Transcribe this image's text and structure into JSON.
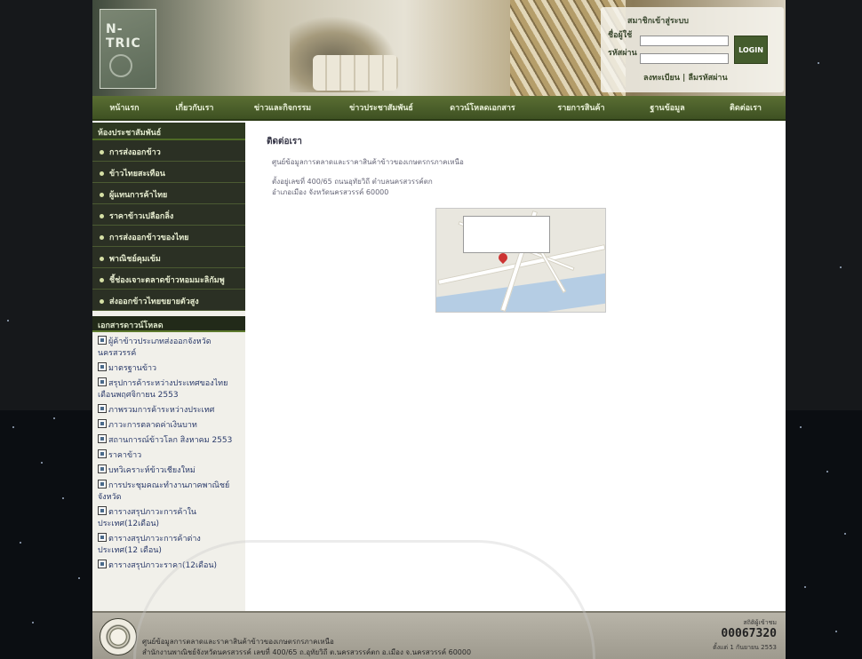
{
  "header": {
    "logo_text": "N-TRIC",
    "login": {
      "title": "สมาชิกเข้าสู่ระบบ",
      "username_label": "ชื่อผู้ใช้",
      "password_label": "รหัสผ่าน",
      "username_placeholder": "",
      "password_placeholder": "",
      "button_label": "LOGIN",
      "links": "ลงทะเบียน | ลืมรหัสผ่าน"
    }
  },
  "nav": {
    "items": [
      "หน้าแรก",
      "เกี่ยวกับเรา",
      "ข่าวและกิจกรรม",
      "ข่าวประชาสัมพันธ์",
      "ดาวน์โหลดเอกสาร",
      "รายการสินค้า",
      "ฐานข้อมูล",
      "ติดต่อเรา"
    ]
  },
  "sidebar": {
    "title": "ห้องประชาสัมพันธ์",
    "items": [
      "การส่งออกข้าว",
      "ข้าวไทยสะเทือน",
      "ผู้แทนการค้าไทย",
      "ราคาข้าวเปลือกลิ่ง",
      "การส่งออกข้าวของไทย",
      "พาณิชย์คุมเข้ม",
      "ชี้ช่องเจาะตลาดข้าวหอมมะลิกัมพู",
      "ส่งออกข้าวไทยขยายตัวสูง"
    ],
    "docs_title": "เอกสารดาวน์โหลด",
    "docs": [
      "ผู้ค้าข้าวประเภทส่งออกจังหวัดนครสวรรค์",
      "มาตรฐานข้าว",
      "สรุปการค้าระหว่างประเทศของไทย เดือนพฤศจิกายน 2553",
      "ภาพรวมการค้าระหว่างประเทศ",
      "ภาวะการตลาดค่าเงินบาท",
      "สถานการณ์ข้าวโลก สิงหาคม 2553",
      "ราคาข้าว",
      "บทวิเคราะห์ข้าวเชียงใหม่",
      "การประชุมคณะทำงานภาคพาณิชย์จังหวัด",
      "ตารางสรุปภาวะการค้าในประเทศ(12เดือน)",
      "ตารางสรุปภาวะการค้าต่างประเทศ(12 เดือน)",
      "ตารางสรุปภาวะราคา(12เดือน)"
    ]
  },
  "content": {
    "title": "ติดต่อเรา",
    "org": "ศูนย์ข้อมูลการตลาดและราคาสินค้าข้าวของเกษตรกรภาคเหนือ",
    "address1": "ตั้งอยู่เลขที่ 400/65 ถนนอุทัยวิถี ตำบลนครสวรรค์ตก",
    "address2": "อำเภอเมือง จังหวัดนครสวรรค์ 60000"
  },
  "footer": {
    "line1": "ศูนย์ข้อมูลการตลาดและราคาสินค้าข้าวของเกษตรกรภาคเหนือ",
    "line2": "สำนักงานพาณิชย์จังหวัดนครสวรรค์ เลขที่ 400/65 ถ.อุทัยวิถี ต.นครสวรรค์ตก อ.เมือง จ.นครสวรรค์ 60000",
    "counter_label": "สถิติผู้เข้าชม",
    "counter_value": "00067320",
    "counter_since": "ตั้งแต่ 1 กันยายน 2553"
  }
}
